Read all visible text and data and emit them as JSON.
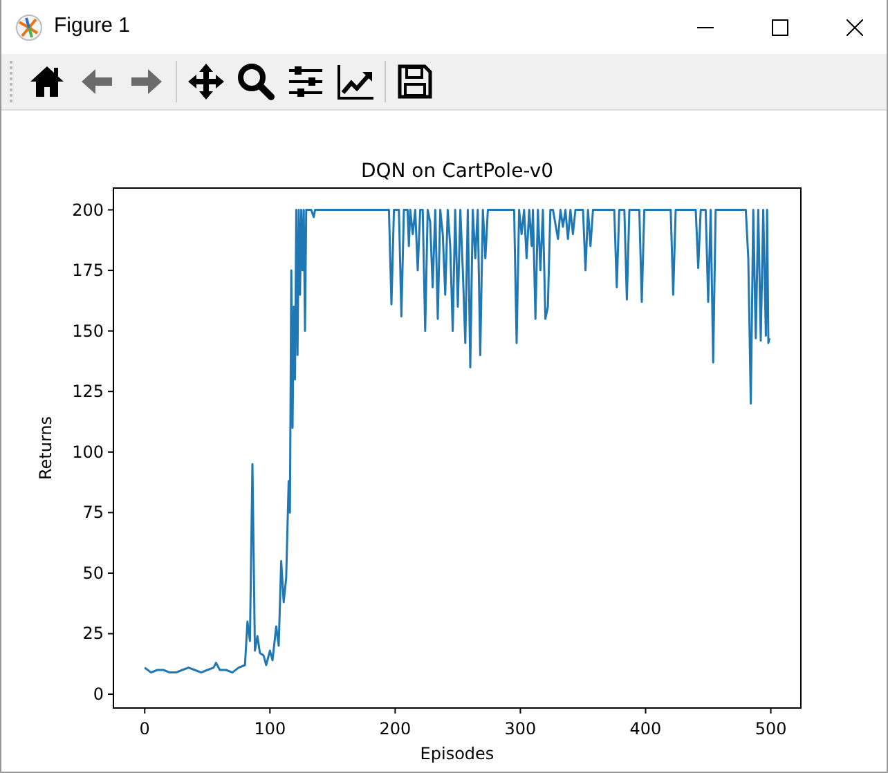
{
  "window": {
    "title": "Figure 1"
  },
  "toolbar": [
    {
      "kind": "home",
      "disabled": false
    },
    {
      "kind": "back",
      "disabled": true
    },
    {
      "kind": "forward",
      "disabled": true
    },
    {
      "kind": "pan",
      "disabled": false
    },
    {
      "kind": "zoom",
      "disabled": false
    },
    {
      "kind": "subplots",
      "disabled": false
    },
    {
      "kind": "axes",
      "disabled": false
    },
    {
      "kind": "save",
      "disabled": false
    }
  ],
  "figure": {
    "chart_data": {
      "type": "line",
      "title": "DQN on CartPole-v0",
      "xlabel": "Episodes",
      "ylabel": "Returns",
      "xlim": [
        -25,
        524
      ],
      "ylim": [
        -5.7,
        209
      ],
      "xticks": [
        0,
        100,
        200,
        300,
        400,
        500
      ],
      "yticks": [
        0,
        25,
        50,
        75,
        100,
        125,
        150,
        175,
        200
      ],
      "x": [
        0,
        5,
        10,
        15,
        20,
        25,
        30,
        35,
        40,
        45,
        50,
        55,
        57,
        60,
        65,
        70,
        75,
        80,
        82,
        84,
        86,
        88,
        90,
        92,
        95,
        97,
        100,
        102,
        105,
        107,
        109,
        111,
        113,
        115,
        116,
        117,
        118,
        119,
        120,
        121,
        122,
        123,
        124,
        125,
        126,
        127,
        128,
        129,
        130,
        133,
        135,
        136,
        140,
        195,
        197,
        199,
        203,
        205,
        207,
        210,
        211,
        212,
        214,
        216,
        218,
        220,
        222,
        224,
        226,
        228,
        230,
        232,
        234,
        236,
        238,
        240,
        242,
        244,
        246,
        248,
        250,
        252,
        254,
        256,
        258,
        260,
        262,
        264,
        266,
        268,
        270,
        272,
        274,
        295,
        297,
        299,
        301,
        303,
        305,
        307,
        309,
        310,
        312,
        314,
        316,
        318,
        320,
        322,
        324,
        326,
        330,
        332,
        334,
        336,
        338,
        340,
        342,
        344,
        350,
        352,
        354,
        356,
        358,
        375,
        377,
        379,
        383,
        385,
        387,
        395,
        397,
        399,
        420,
        422,
        424,
        440,
        442,
        444,
        448,
        450,
        452,
        454,
        456,
        480,
        482,
        484,
        486,
        488,
        490,
        492,
        494,
        496,
        497,
        498,
        499
      ],
      "series": [
        {
          "color": "#1f77b4",
          "values": [
            11,
            9,
            10,
            10,
            9,
            9,
            10,
            11,
            10,
            9,
            10,
            11,
            13,
            10,
            10,
            9,
            11,
            12,
            30,
            22,
            95,
            18,
            24,
            17,
            16,
            12,
            18,
            14,
            28,
            20,
            55,
            38,
            48,
            88,
            75,
            175,
            110,
            160,
            130,
            200,
            140,
            200,
            165,
            200,
            175,
            200,
            150,
            200,
            200,
            200,
            197,
            200,
            200,
            200,
            161,
            200,
            200,
            156,
            200,
            200,
            185,
            200,
            190,
            200,
            175,
            200,
            200,
            150,
            200,
            195,
            168,
            200,
            155,
            200,
            190,
            165,
            200,
            185,
            150,
            200,
            160,
            200,
            175,
            145,
            200,
            135,
            200,
            180,
            200,
            140,
            200,
            180,
            200,
            200,
            145,
            200,
            190,
            200,
            180,
            200,
            185,
            200,
            155,
            200,
            175,
            200,
            155,
            160,
            200,
            200,
            188,
            200,
            193,
            200,
            188,
            200,
            190,
            200,
            200,
            175,
            200,
            185,
            200,
            200,
            168,
            200,
            200,
            163,
            200,
            200,
            162,
            200,
            200,
            165,
            200,
            200,
            176,
            200,
            200,
            162,
            200,
            137,
            200,
            200,
            180,
            120,
            200,
            147,
            200,
            146,
            200,
            148,
            200,
            145,
            147
          ]
        }
      ]
    }
  }
}
